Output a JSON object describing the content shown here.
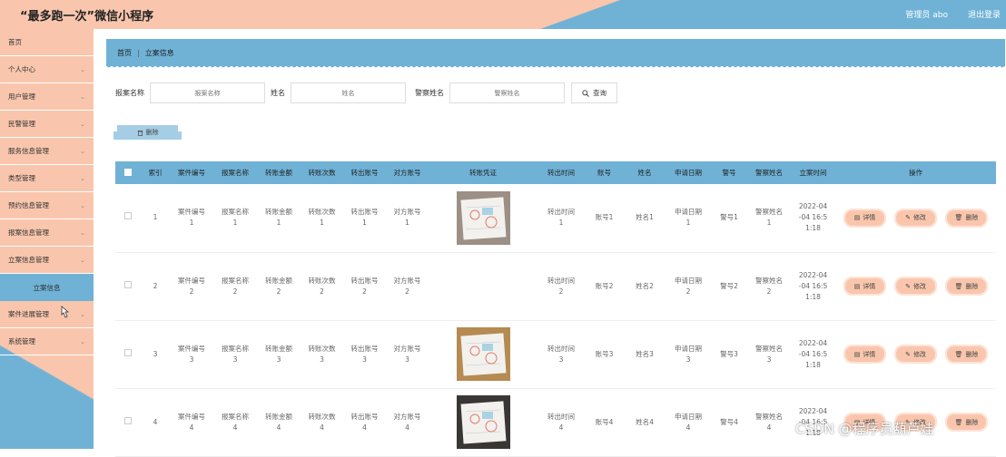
{
  "header": {
    "title": "“最多跑一次”微信小程序",
    "admin_label": "管理员 abo",
    "logout_label": "退出登录"
  },
  "sidebar": {
    "items": [
      {
        "label": "首页",
        "chevron": false
      },
      {
        "label": "个人中心",
        "chevron": true
      },
      {
        "label": "用户管理",
        "chevron": true
      },
      {
        "label": "民警管理",
        "chevron": true
      },
      {
        "label": "服务信息管理",
        "chevron": true
      },
      {
        "label": "类型管理",
        "chevron": true
      },
      {
        "label": "预约信息管理",
        "chevron": true
      },
      {
        "label": "报案信息管理",
        "chevron": true
      },
      {
        "label": "立案信息管理",
        "chevron": true
      }
    ],
    "active_sub": "立案信息",
    "items_after": [
      {
        "label": "案件进展管理",
        "chevron": true
      },
      {
        "label": "系统管理",
        "chevron": true
      }
    ]
  },
  "breadcrumb": {
    "home": "首页",
    "sep": "|",
    "current": "立案信息"
  },
  "search": {
    "f1_label": "报案名称",
    "f1_placeholder": "报案名称",
    "f2_label": "姓名",
    "f2_placeholder": "姓名",
    "f3_label": "警察姓名",
    "f3_placeholder": "警察姓名",
    "query_label": "查询"
  },
  "delete_label": "删除",
  "table": {
    "headers": [
      "",
      "索引",
      "案件编号",
      "报案名称",
      "转账金额",
      "转账次数",
      "转出账号",
      "对方账号",
      "转账凭证",
      "转出时间",
      "账号",
      "姓名",
      "申请日期",
      "警号",
      "警察姓名",
      "立案时间",
      "操作"
    ],
    "rows": [
      {
        "idx": "1",
        "c1": "案件编号\n1",
        "c2": "报案名称\n1",
        "c3": "转账金额\n1",
        "c4": "转账次数\n1",
        "c5": "转出账号\n1",
        "c6": "对方账号\n1",
        "pic": true,
        "c7": "转出时间\n1",
        "c8": "账号1",
        "c9": "姓名1",
        "c10": "申请日期\n1",
        "c11": "警号1",
        "c12": "警察姓名\n1",
        "c13": "2022-04\n-04 16:5\n1:18"
      },
      {
        "idx": "2",
        "c1": "案件编号\n2",
        "c2": "报案名称\n2",
        "c3": "转账金额\n2",
        "c4": "转账次数\n2",
        "c5": "转出账号\n2",
        "c6": "对方账号\n2",
        "pic": false,
        "c7": "转出时间\n2",
        "c8": "账号2",
        "c9": "姓名2",
        "c10": "申请日期\n2",
        "c11": "警号2",
        "c12": "警察姓名\n2",
        "c13": "2022-04\n-04 16:5\n1:18"
      },
      {
        "idx": "3",
        "c1": "案件编号\n3",
        "c2": "报案名称\n3",
        "c3": "转账金额\n3",
        "c4": "转账次数\n3",
        "c5": "转出账号\n3",
        "c6": "对方账号\n3",
        "pic": true,
        "c7": "转出时间\n3",
        "c8": "账号3",
        "c9": "姓名3",
        "c10": "申请日期\n3",
        "c11": "警号3",
        "c12": "警察姓名\n3",
        "c13": "2022-04\n-04 16:5\n1:18"
      },
      {
        "idx": "4",
        "c1": "案件编号\n4",
        "c2": "报案名称\n4",
        "c3": "转账金额\n4",
        "c4": "转账次数\n4",
        "c5": "转出账号\n4",
        "c6": "对方账号\n4",
        "pic": true,
        "c7": "转出时间\n4",
        "c8": "账号4",
        "c9": "姓名4",
        "c10": "申请日期\n4",
        "c11": "警号4",
        "c12": "警察姓名\n4",
        "c13": "2022-04\n-04 16:5\n1:18"
      }
    ],
    "ops": {
      "detail": "详情",
      "edit": "修改",
      "delete": "删除"
    }
  },
  "watermark": "CSDN @程序员葫芦娃",
  "colors": {
    "peach": "#f9c6ad",
    "blue": "#6fb2d6"
  }
}
